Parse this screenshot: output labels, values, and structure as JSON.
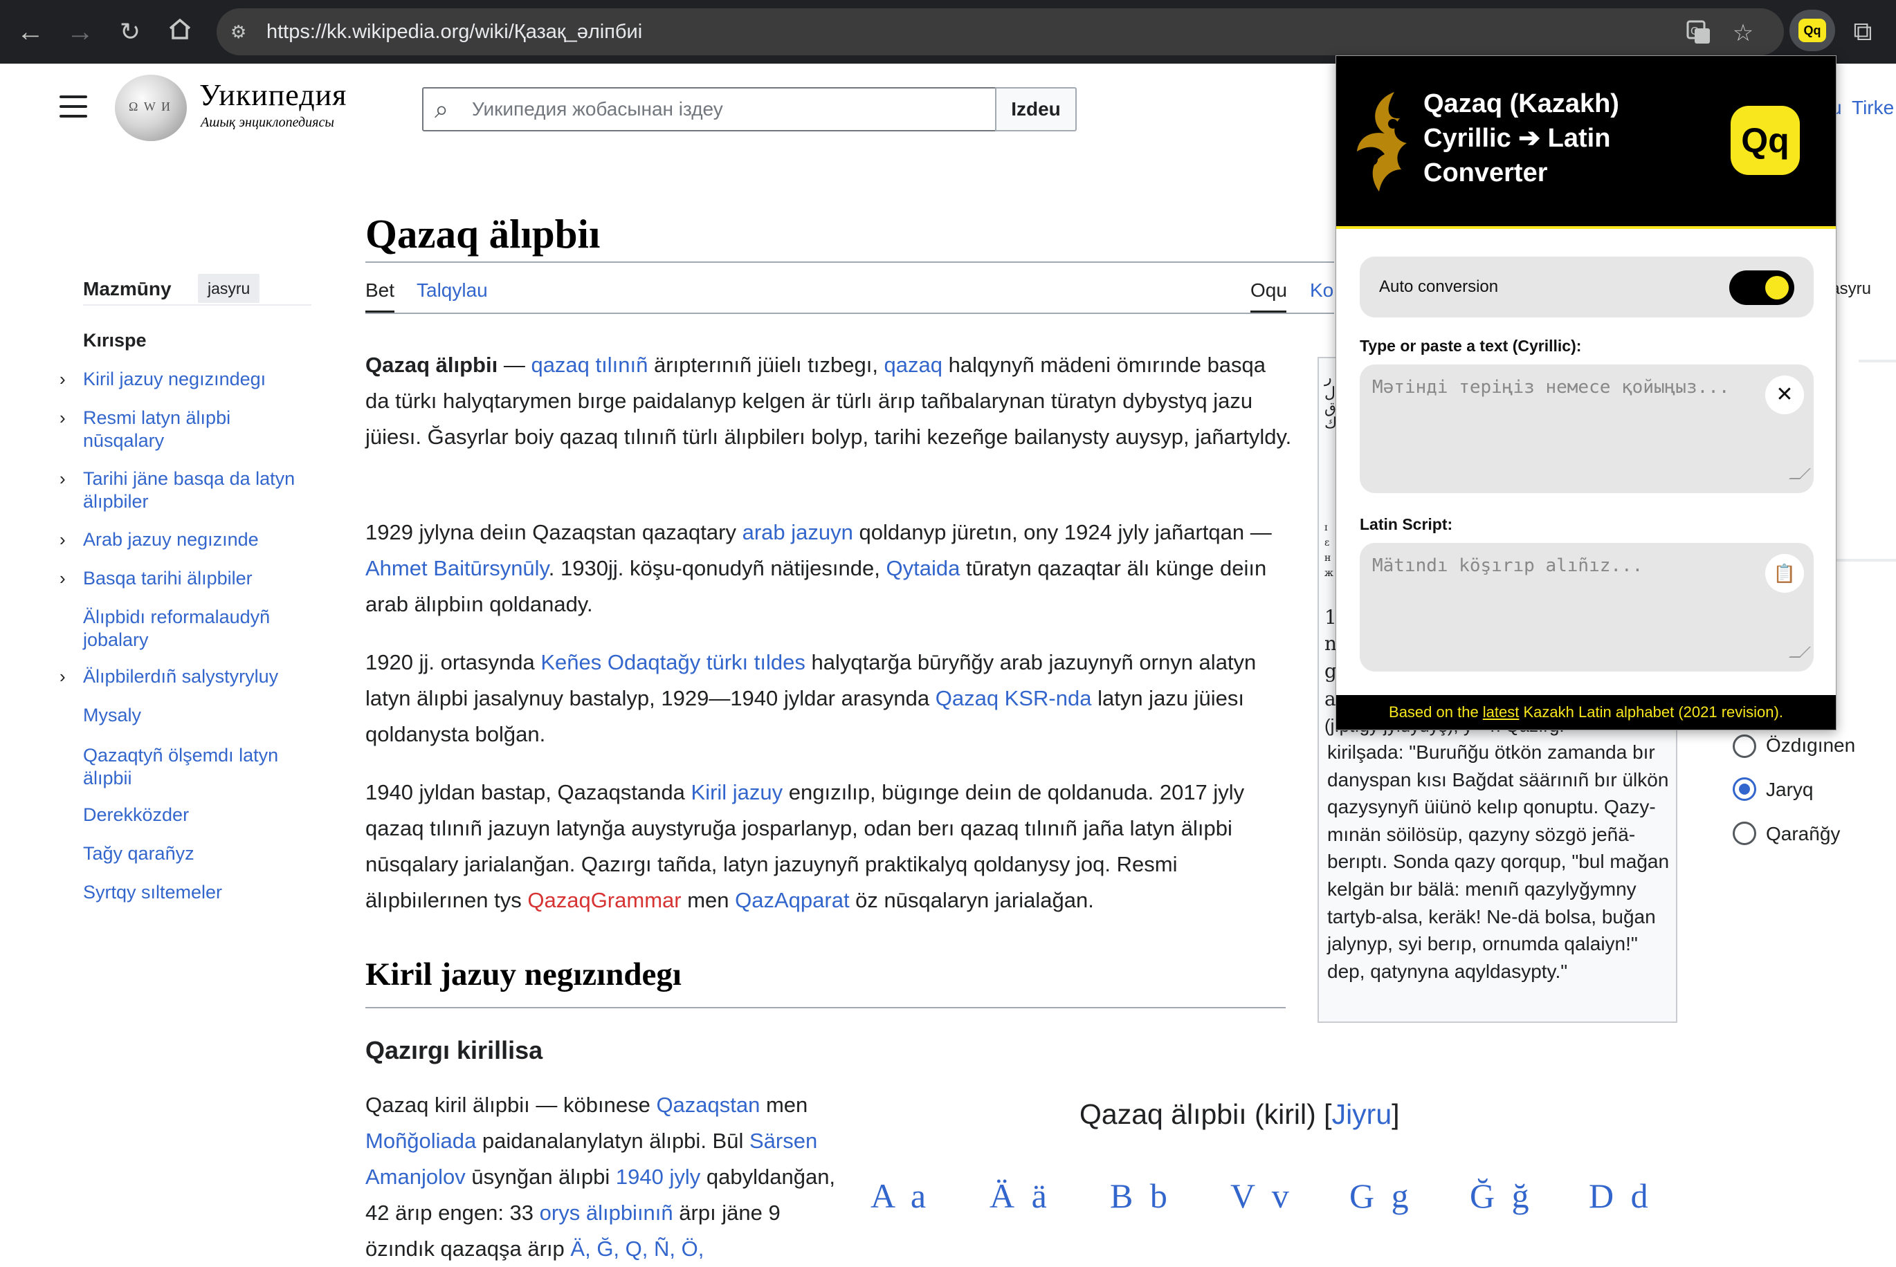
{
  "browser": {
    "url": "https://kk.wikipedia.org/wiki/Қазақ_әліпбиі",
    "back_icon": "arrow-left-icon",
    "forward_icon": "arrow-right-icon",
    "reload_icon": "reload-icon",
    "home_icon": "home-icon"
  },
  "wiki": {
    "wordmark": "Уикипедия",
    "tagline": "Ашық энциклопедиясы",
    "search_placeholder": "Уикипедия жобасынан іздеу",
    "search_button": "Izdeu",
    "tirke": "Tirke",
    "u_frag": "u"
  },
  "toc": {
    "title": "Mazmūny",
    "hide": "jasyru",
    "items": [
      "Kırıspe",
      "Kiril jazuy negızındegı",
      "Resmi latyn älıpbi nūsqalary",
      "Tarihi jäne basqa da latyn älıpbiler",
      "Arab jazuy negızınde",
      "Basqa tarihi älıpbiler",
      "Älıpbidı reformalaudyñ jobalary",
      "Älıpbilerdıñ salystyryluy",
      "Mysaly",
      "Qazaqtyñ ölşemdı latyn älıpbii",
      "Derekközder",
      "Tağy qarañyz",
      "Syrtqy sıltemeler"
    ]
  },
  "article": {
    "title": "Qazaq älıpbiı",
    "tabs": [
      "Bet",
      "Talqylau",
      "Oqu",
      "Ko"
    ],
    "p1": {
      "bold": "Qazaq älıpbiı",
      "t1": " — ",
      "l1": "qazaq tılınıñ",
      "t2": " ärıpterınıñ jüielı tızbegı, ",
      "l2": "qazaq",
      "t3": " halqynyñ mädeni ömırınde basqa da türkı halyqtarymen bırge paidalanyp kelgen är türlı ärıp tañbalarynan türatyn dybystyq jazu jüiesı. Ğasyrlar boiy qazaq tılınıñ türlı älıpbilerı bolyp, tarihi kezeñge bailanysty auysyp, jañartyldy."
    },
    "p2": {
      "t1": "1929 jylyna deiın Qazaqstan qazaqtary ",
      "l1": "arab jazuyn",
      "t2": " qoldanyp jüretın, ony 1924 jyly jañartqan — ",
      "l2": "Ahmet Baitūrsynūly",
      "t3": ". 1930jj. köşu-qonudyñ nätijesınde, ",
      "l3": "Qytaida",
      "t4": " tūratyn qazaqtar älı künge deiın arab älıpbiın qoldanady."
    },
    "p3": {
      "t1": "1920 jj. ortasynda ",
      "l1": "Keñes Odaqtağy türkı tıldes",
      "t2": " halyqtarğa būryñğy arab jazuynyñ ornyn alatyn latyn älıpbi jasalynuy bastalyp, 1929—1940 jyldar arasynda ",
      "l2": "Qazaq KSR-nda",
      "t3": " latyn jazu jüiesı qoldanysta bolğan."
    },
    "p4": {
      "t1": "1940 jyldan bastap, Qazaqstanda ",
      "l1": "Kiril jazuy",
      "t2": " engızılıp, bügınge deiın de qoldanuda. 2017 jyly qazaq tılınıñ jazuyn latynğa auystyruğa josparlanyp, odan berı qazaq tılınıñ jaña latyn älıpbi nūsqalary jarialanğan. Qazırgı tañda, latyn jazuynyñ praktikalyq qoldanysy joq. Resmi älıpbiılerınen tys ",
      "l2": "QazaqGrammar",
      "t3": " men ",
      "l3": "QazAqparat",
      "t4": " öz nūsqalaryn jarialağan."
    },
    "h2": "Kiril jazuy negızındegı",
    "h3": "Qazırgı kirillisa",
    "p5": {
      "t1": "Qazaq kiril älıpbiı — köbınese ",
      "l1": "Qazaqstan",
      "t2": " men ",
      "l2": "Moñğoliada",
      "t3": " paidanalanylatyn älıpbi. Būl ",
      "l3": "Särsen Amanjolov",
      "t4": " ūsynğan älıpbi ",
      "l4": "1940 jyly",
      "t5": " qabyldanğan, 42 ärıp engen: 33 ",
      "l5": "orys älıpbiınıñ",
      "t6": " ärpı jäne 9 özındık qazaqşa ärıp ",
      "l6": "Ä, Ğ, Q, Ñ, Ö,"
    },
    "table_caption_a": "Qazaq älıpbiı (kiril) [",
    "table_caption_link": "Jiyru",
    "table_caption_b": "]",
    "letters": [
      "A a",
      "Ä ä",
      "B b",
      "V v",
      "G g",
      "Ğ ğ",
      "D d"
    ]
  },
  "infobox": {
    "frag_top": "1",
    "frag_n": "n",
    "frag_g": "g",
    "frag_a": "a",
    "frag_line": "(jıptığy jyluyuyş), y—ʜ Qazırg.",
    "text": "kirilşada: \"Buruñğu ötkön zamanda bır danyspan kısı Bağdat säärınıñ bır ülkön qazysynyñ üiünö kelıp qonuptu. Qazy-mınän söilösüp, qazyny sözgö jeñä-berıptı. Sonda qazy qorqup, \"bul mağan kelgän bır bälä: menıñ qazylyğymny tartyb-alsa, keräk! Ne-dä bolsa, buğan jalynyp, syi berıp, ornumda qalaiyn!\" dep, qatynyna aqyldasypty.\""
  },
  "right_sidebar": {
    "jasyru": "jasyru",
    "options": [
      "Özdıgınen",
      "Jaryq",
      "Qarañğy"
    ],
    "selected": "Jaryq"
  },
  "extension": {
    "title": "Qazaq (Kazakh) Cyrillic ➔ Latin Converter",
    "logo": "Qq",
    "auto_conversion_label": "Auto conversion",
    "auto_conversion": true,
    "input_label": "Type or paste a text (Cyrillic):",
    "input_placeholder": "Мәтінді теріңіз немесе қойыңыз...",
    "input_value": "",
    "output_label": "Latin Script:",
    "output_placeholder": "Mätındı köşırıp alıñız...",
    "output_value": "",
    "footer_a": "Based on the ",
    "footer_link": "latest",
    "footer_b": " Kazakh Latin alphabet (2021 revision).",
    "accent": "#f8e71c"
  }
}
